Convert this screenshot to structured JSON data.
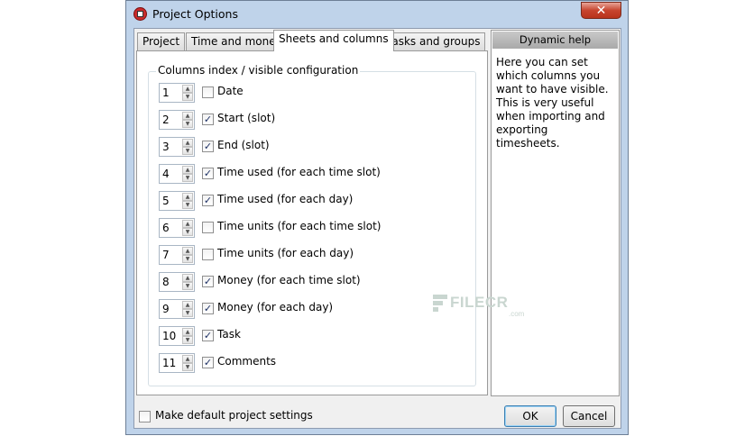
{
  "window": {
    "title": "Project Options",
    "close_glyph": "✕"
  },
  "tabs": [
    {
      "label": "Project"
    },
    {
      "label": "Time and money"
    },
    {
      "label": "Sheets and columns",
      "active": true
    },
    {
      "label": "Tasks and groups"
    }
  ],
  "group": {
    "label": "Columns index / visible configuration"
  },
  "columns": [
    {
      "index": "1",
      "label": "Date",
      "checked": false
    },
    {
      "index": "2",
      "label": "Start (slot)",
      "checked": true
    },
    {
      "index": "3",
      "label": "End (slot)",
      "checked": true
    },
    {
      "index": "4",
      "label": "Time used (for each time slot)",
      "checked": true
    },
    {
      "index": "5",
      "label": "Time used (for each day)",
      "checked": true
    },
    {
      "index": "6",
      "label": "Time units (for each time slot)",
      "checked": false
    },
    {
      "index": "7",
      "label": "Time units (for each day)",
      "checked": false
    },
    {
      "index": "8",
      "label": "Money (for each time slot)",
      "checked": true
    },
    {
      "index": "9",
      "label": "Money (for each day)",
      "checked": true
    },
    {
      "index": "10",
      "label": "Task",
      "checked": true
    },
    {
      "index": "11",
      "label": "Comments",
      "checked": true
    }
  ],
  "help": {
    "title": "Dynamic help",
    "text": "Here you can set which columns you want to have visible. This is very useful when importing and exporting timesheets."
  },
  "footer": {
    "default_settings_label": "Make default project settings",
    "default_settings_checked": false,
    "ok_label": "OK",
    "cancel_label": "Cancel"
  },
  "watermark": {
    "text": "FILECR",
    "sub": ".com"
  },
  "colors": {
    "accent": "#1c2f63",
    "window_frame": "#bfd3ea",
    "close_red": "#c7452f"
  }
}
